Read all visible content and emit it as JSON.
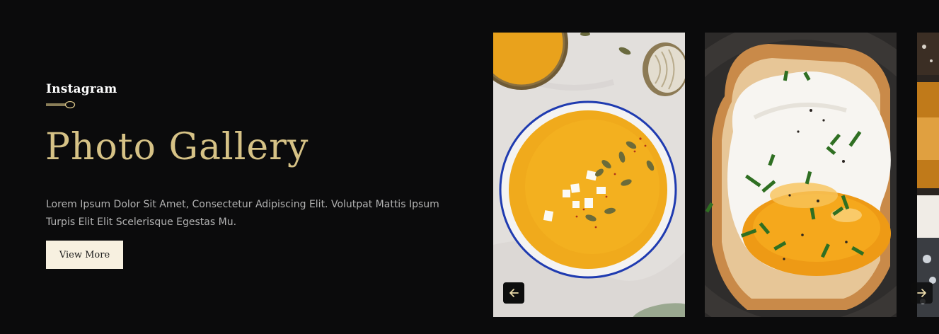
{
  "section": {
    "eyebrow": "Instagram",
    "title": "Photo Gallery",
    "description": "Lorem Ipsum Dolor Sit Amet, Consectetur Adipiscing Elit. Volutpat Mattis Ipsum Turpis Elit Elit Scelerisque Egestas Mu.",
    "button_label": "View More"
  },
  "gallery": {
    "images": [
      {
        "subject": "pumpkin soup bowl with pumpkin seeds and feta"
      },
      {
        "subject": "fried egg on toast with chives"
      },
      {
        "subject": "partial food image"
      }
    ],
    "prev_icon": "arrow-left-icon",
    "next_icon": "arrow-right-icon"
  },
  "colors": {
    "background": "#0b0b0c",
    "accent_gold": "#d6c286",
    "button_bg": "#f7f0e0",
    "text_muted": "#b3b3b3"
  }
}
